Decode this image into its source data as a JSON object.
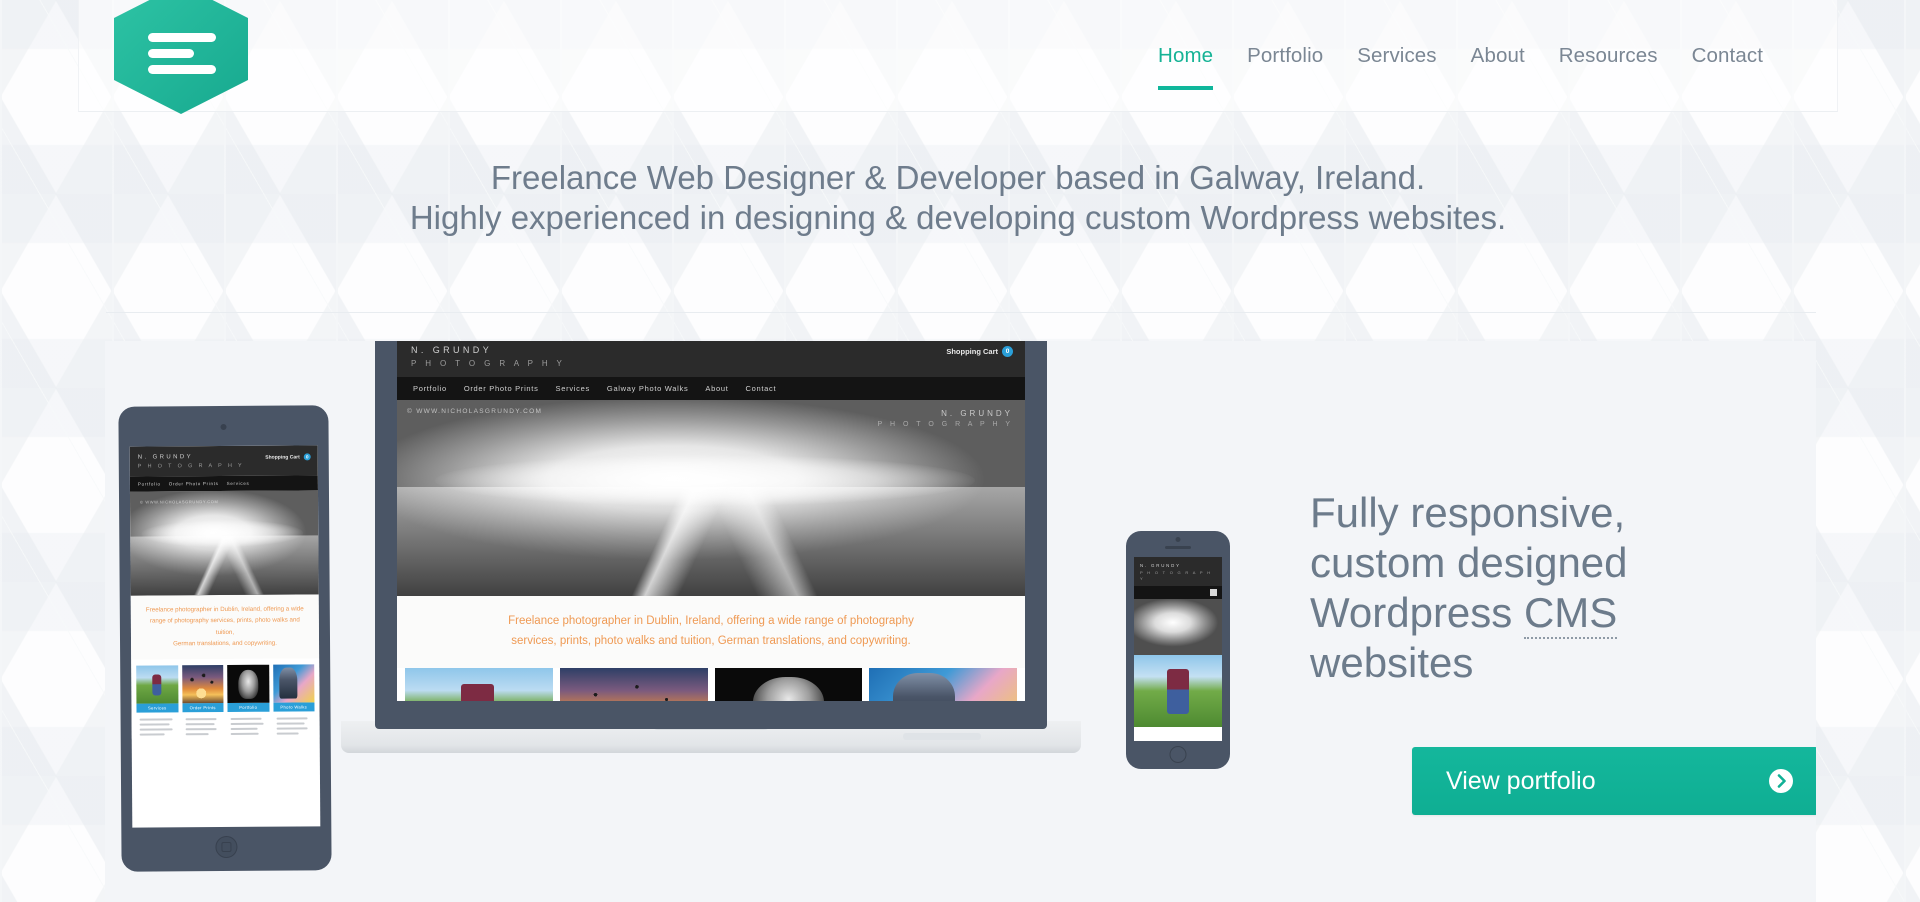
{
  "theme": {
    "accent": "#0fb69b",
    "accent_dark": "#14b79c",
    "text_muted": "#6e7c8c",
    "heading": "#6c7b8b",
    "panel_bg": "#f3f5f8",
    "caption_orange": "#ef9a54",
    "device_body": "#4a5566",
    "inner_nav_blue": "#2a9fd8"
  },
  "header": {
    "logo_name": "hexagon-menu-logo",
    "nav": [
      {
        "label": "Home",
        "active": true
      },
      {
        "label": "Portfolio",
        "active": false
      },
      {
        "label": "Services",
        "active": false
      },
      {
        "label": "About",
        "active": false
      },
      {
        "label": "Resources",
        "active": false
      },
      {
        "label": "Contact",
        "active": false
      }
    ]
  },
  "tagline": {
    "line1": "Freelance Web Designer & Developer based in Galway, Ireland.",
    "line2": "Highly experienced in designing & developing custom Wordpress websites."
  },
  "hero": {
    "heading_part1": "Fully responsive, custom designed Wordpress ",
    "heading_abbr": "CMS",
    "heading_part2": " websites",
    "cta_label": "View portfolio",
    "cta_icon": "circle-chevron-right-icon"
  },
  "mockup_site": {
    "brand_line1": "N.    GRUNDY",
    "brand_line2": "P H O T O G R A P H Y",
    "cart_label": "Shopping Cart",
    "cart_count": "0",
    "nav": [
      "Portfolio",
      "Order Photo Prints",
      "Services",
      "Galway Photo Walks",
      "About",
      "Contact"
    ],
    "watermark": "© WWW.NICHOLASGRUNDY.COM",
    "caption_line1": "Freelance photographer in Dublin, Ireland, offering a wide range of photography",
    "caption_line2": "services, prints, photo walks and tuition, German translations, and copywriting.",
    "tablet_caption_line1": "Freelance photographer in Dublin, Ireland, offering a wide",
    "tablet_caption_line2": "range of photography services, prints, photo walks and tuition,",
    "tablet_caption_line3": "German translations, and copywriting.",
    "cards": [
      {
        "label": "Services",
        "image": "cyclist-photo"
      },
      {
        "label": "Order Prints",
        "image": "balloons-photo"
      },
      {
        "label": "Portfolio",
        "image": "gorilla-photo"
      },
      {
        "label": "Photo Walks",
        "image": "photographer-photo"
      }
    ]
  }
}
